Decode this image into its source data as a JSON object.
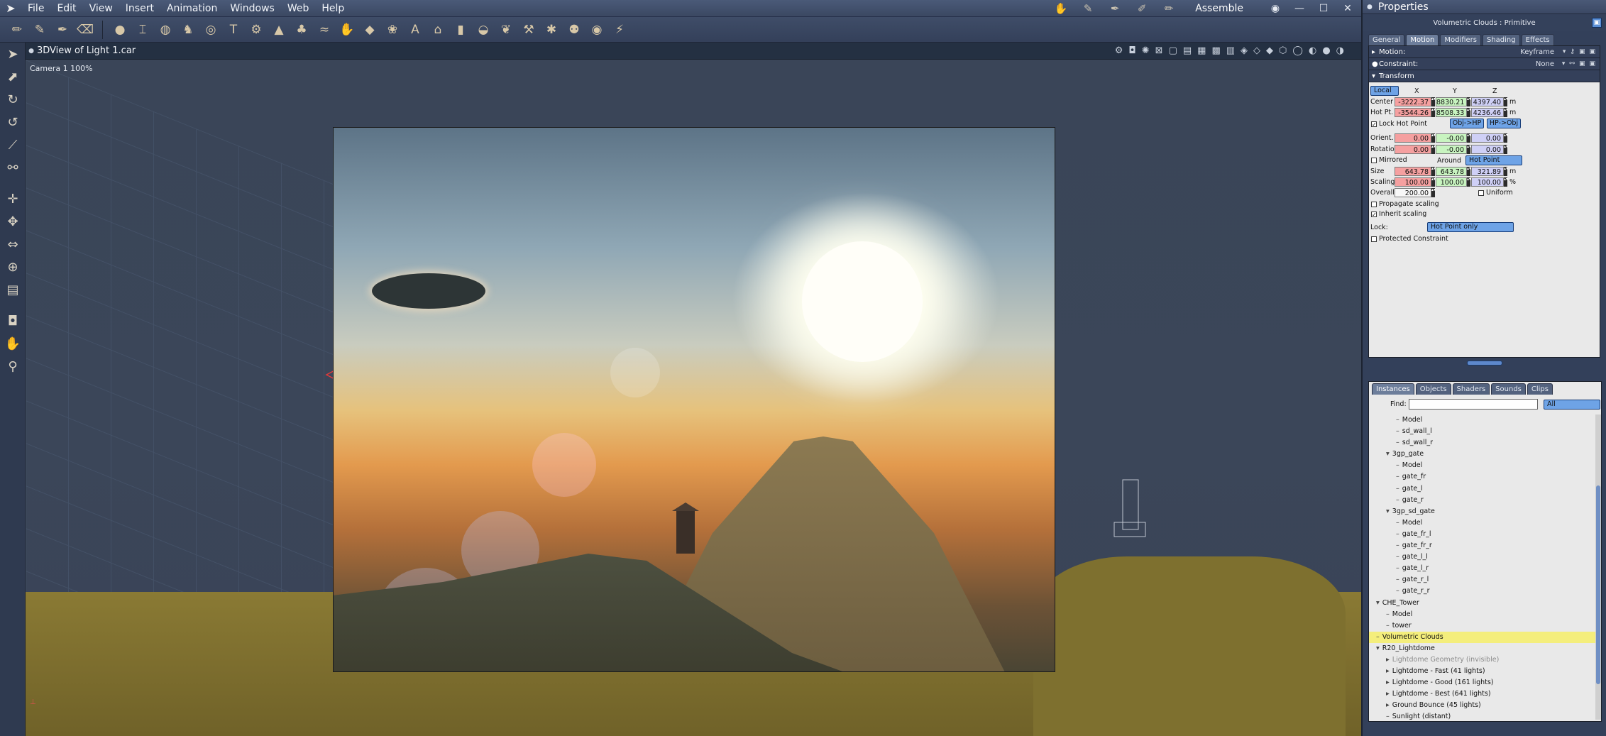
{
  "menu": {
    "items": [
      "File",
      "Edit",
      "View",
      "Insert",
      "Animation",
      "Windows",
      "Web",
      "Help"
    ],
    "room": "Assemble"
  },
  "view": {
    "title": "3DView of Light 1.car",
    "camera": "Camera 1 100%"
  },
  "properties": {
    "title": "Properties",
    "object": "Volumetric Clouds : Primitive",
    "tabs": [
      "General",
      "Motion",
      "Modifiers",
      "Shading",
      "Effects"
    ],
    "active_tab": "Motion",
    "motion": {
      "label": "Motion:",
      "value": "Keyframe"
    },
    "constraint": {
      "label": "Constraint:",
      "value": "None"
    },
    "transform": {
      "label": "Transform",
      "space": "Local",
      "cols": [
        "X",
        "Y",
        "Z"
      ],
      "center": {
        "label": "Center",
        "x": "-3222.37",
        "y": "8830.21",
        "z": "4397.40",
        "unit": "m"
      },
      "hotpt": {
        "label": "Hot Pt.",
        "x": "-3544.26",
        "y": "8508.33",
        "z": "4236.46",
        "unit": "m"
      },
      "lock_hot_point": "Lock Hot Point",
      "obj_hp": "Obj->HP",
      "hp_obj": "HP->Obj",
      "orient": {
        "label": "Orient.",
        "x": "0.00",
        "y": "-0.00",
        "z": "0.00"
      },
      "rotation": {
        "label": "Rotation",
        "x": "0.00",
        "y": "-0.00",
        "z": "0.00"
      },
      "mirrored": "Mirrored",
      "around": "Around",
      "around_value": "Hot Point",
      "size": {
        "label": "Size",
        "x": "643.78",
        "y": "643.78",
        "z": "321.89",
        "unit": "m"
      },
      "scaling": {
        "label": "Scaling",
        "x": "100.00",
        "y": "100.00",
        "z": "100.00",
        "unit": "%"
      },
      "overall": {
        "label": "Overall",
        "value": "200.00"
      },
      "uniform": "Uniform",
      "propagate": "Propagate scaling",
      "inherit": "Inherit scaling",
      "lock": {
        "label": "Lock:",
        "value": "Hot Point only"
      },
      "protected": "Protected Constraint"
    }
  },
  "browser": {
    "tabs": [
      "Instances",
      "Objects",
      "Shaders",
      "Sounds",
      "Clips"
    ],
    "active_tab": "Instances",
    "find_label": "Find:",
    "find_value": "",
    "filter": "All",
    "items": [
      {
        "t": "Model",
        "d": 2
      },
      {
        "t": "sd_wall_l",
        "d": 2
      },
      {
        "t": "sd_wall_r",
        "d": 2
      },
      {
        "t": "3gp_gate",
        "d": 1,
        "open": true
      },
      {
        "t": "Model",
        "d": 2
      },
      {
        "t": "gate_fr",
        "d": 2
      },
      {
        "t": "gate_l",
        "d": 2
      },
      {
        "t": "gate_r",
        "d": 2
      },
      {
        "t": "3gp_sd_gate",
        "d": 1,
        "open": true
      },
      {
        "t": "Model",
        "d": 2
      },
      {
        "t": "gate_fr_l",
        "d": 2
      },
      {
        "t": "gate_fr_r",
        "d": 2
      },
      {
        "t": "gate_l_l",
        "d": 2
      },
      {
        "t": "gate_l_r",
        "d": 2
      },
      {
        "t": "gate_r_l",
        "d": 2
      },
      {
        "t": "gate_r_r",
        "d": 2
      },
      {
        "t": "CHE_Tower",
        "d": 0,
        "open": true
      },
      {
        "t": "Model",
        "d": 1
      },
      {
        "t": "tower",
        "d": 1
      },
      {
        "t": "Volumetric Clouds",
        "d": 0,
        "sel": true
      },
      {
        "t": "R20_Lightdome",
        "d": 0,
        "open": true
      },
      {
        "t": "Lightdome Geometry (invisible)",
        "d": 1,
        "dim": true,
        "closed": true
      },
      {
        "t": "Lightdome - Fast (41 lights)",
        "d": 1,
        "closed": true
      },
      {
        "t": "Lightdome - Good (161 lights)",
        "d": 1,
        "closed": true
      },
      {
        "t": "Lightdome - Best (641 lights)",
        "d": 1,
        "closed": true
      },
      {
        "t": "Ground Bounce (45 lights)",
        "d": 1,
        "closed": true
      },
      {
        "t": "Sunlight (distant)",
        "d": 1
      }
    ]
  }
}
